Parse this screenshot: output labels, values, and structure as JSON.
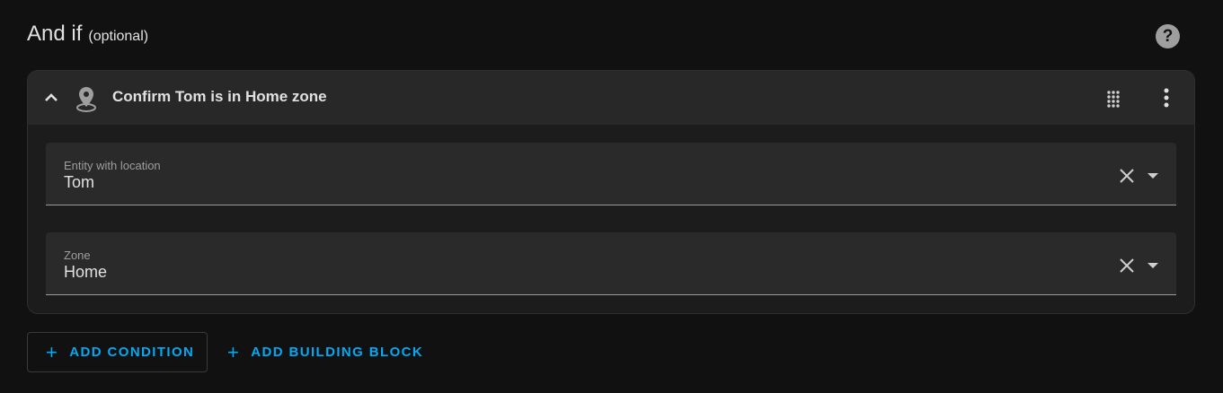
{
  "section": {
    "title": "And if",
    "optional": "(optional)",
    "help_icon": "help-circle-icon"
  },
  "condition_card": {
    "title": "Confirm Tom is in Home zone",
    "expanded": true,
    "icons": {
      "collapse": "chevron-up-icon",
      "type": "map-marker-icon",
      "drag": "drag-handle-icon",
      "menu": "dots-vertical-icon"
    },
    "fields": [
      {
        "label": "Entity with location",
        "value": "Tom"
      },
      {
        "label": "Zone",
        "value": "Home"
      }
    ]
  },
  "actions": {
    "add_condition": "ADD CONDITION",
    "add_building_block": "ADD BUILDING BLOCK",
    "plus_glyph": "+"
  },
  "colors": {
    "background": "#111111",
    "card": "#1c1c1c",
    "card_header": "#282828",
    "field": "#2a2a2a",
    "accent": "#03a9f4",
    "text": "#e1e1e1",
    "muted": "#9e9e9e"
  }
}
